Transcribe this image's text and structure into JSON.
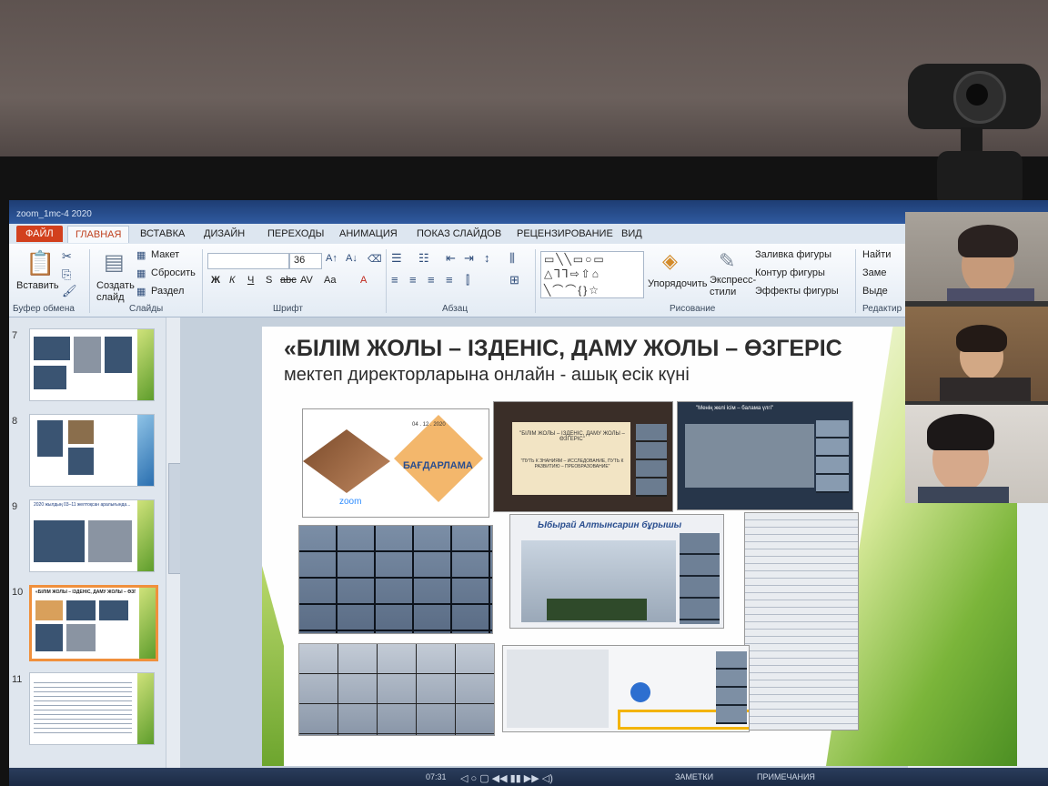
{
  "window": {
    "title": "zoom_1mc-4 2020"
  },
  "menu": {
    "tabs": [
      "ФАЙЛ",
      "ГЛАВНАЯ",
      "ВСТАВКА",
      "ДИЗАЙН",
      "ПЕРЕХОДЫ",
      "АНИМАЦИЯ",
      "ПОКАЗ СЛАЙДОВ",
      "РЕЦЕНЗИРОВАНИЕ",
      "ВИД"
    ],
    "active": "ГЛАВНАЯ"
  },
  "ribbon": {
    "paste": "Вставить",
    "new_slide": "Создать слайд",
    "layout": "Макет",
    "reset": "Сбросить",
    "section": "Раздел",
    "font_size": "36",
    "arrange": "Упорядочить",
    "quick_styles": "Экспресс-стили",
    "shape_fill": "Заливка фигуры",
    "shape_outline": "Контур фигуры",
    "shape_effects": "Эффекты фигуры",
    "find": "Найти",
    "replace": "Заме",
    "select": "Выде",
    "format_buttons": [
      "Ж",
      "К",
      "Ч",
      "S",
      "abc",
      "AV",
      "Aa",
      "A"
    ],
    "groups": {
      "clipboard": "Буфер обмена",
      "slides": "Слайды",
      "font": "Шрифт",
      "paragraph": "Абзац",
      "drawing": "Рисование",
      "editing": "Редактир"
    }
  },
  "thumbnails": [
    {
      "num": "7",
      "text": ""
    },
    {
      "num": "8",
      "text": ""
    },
    {
      "num": "9",
      "text": "2020 жылдың 03–11 желтоқсан аралығында..."
    },
    {
      "num": "10",
      "text": "«БІЛІМ ЖОЛЫ – ІЗДЕНІС, ДАМУ ЖОЛЫ – ӨЗГЕРІС»",
      "selected": true
    },
    {
      "num": "11",
      "text": ""
    }
  ],
  "slide": {
    "title": "«БІЛІМ ЖОЛЫ – ІЗДЕНІС, ДАМУ ЖОЛЫ – ӨЗГЕРІС",
    "subtitle": "мектеп директорларына онлайн - ашық есік күні",
    "photo_captions": {
      "program": "БАҒДАРЛАМА",
      "zoom": "zoom",
      "date": "04 . 12 . 2020",
      "banner": "\"БІЛІМ ЖОЛЫ – ІЗДЕНІС, ДАМУ ЖОЛЫ – ӨЗГЕРІС\"",
      "banner_ru": "\"ПУТЬ К ЗНАНИЯМ – ИССЛЕДОВАНИЕ, ПУТЬ К РАЗВИТИЮ – ПРЕОБРАЗОВАНИЕ\"",
      "corner": "Ыбырай Алтынсарин бұрышы",
      "meeting": "\"Менің желі ісім – балама үлгі\""
    }
  },
  "statusbar": {
    "time": "07:31",
    "notes": "ЗАМЕТКИ",
    "comments": "ПРИМЕЧАНИЯ"
  },
  "colors": {
    "file_tab": "#d2401d",
    "accent_green": "#6da52e",
    "selection": "#f0903c"
  }
}
